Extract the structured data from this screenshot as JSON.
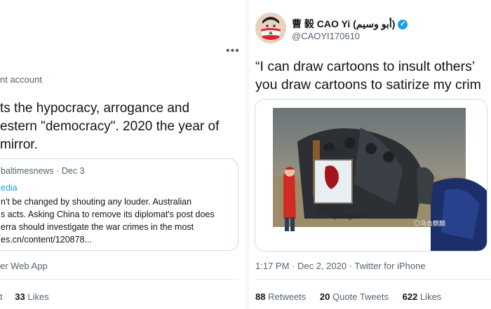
{
  "left_tweet": {
    "author_note": "nt account",
    "body_lines": [
      "ts the hypocracy, arrogance and",
      "estern \"democracy\". 2020 the year of",
      " mirror."
    ],
    "quote": {
      "handle_date": "baltimesnews · Dec 3",
      "label": "edia",
      "lines": [
        "n't be changed by shouting any louder. Australian",
        "s acts. Asking China to remove its diplomat's post does",
        "erra should investigate the war crimes in the most",
        "es.cn/content/120878..."
      ]
    },
    "source": "er Web App",
    "stats": {
      "partial_label": "t",
      "likes_count": "33",
      "likes_label": "Likes"
    }
  },
  "right_tweet": {
    "display_name": "曹 毅 CAO Yi (أبو وسيم)",
    "handle": "@CAOYI170610",
    "body_lines": [
      "“I can draw cartoons to insult others’",
      "you draw cartoons to satirize my crim"
    ],
    "image_caption": "-apologize!!-",
    "image_watermark": "◎乌合麒麟",
    "timestamp": "1:17 PM · Dec 2, 2020 · Twitter for iPhone",
    "stats": {
      "retweets_count": "88",
      "retweets_label": "Retweets",
      "quote_count": "20",
      "quote_label": "Quote Tweets",
      "likes_count": "622",
      "likes_label": "Likes"
    }
  },
  "colors": {
    "link_blue": "#1d9bf0",
    "text": "#0f1419",
    "secondary": "#536471",
    "border": "#cfd9de"
  },
  "icons": [
    "more-icon",
    "verified-icon",
    "avatar",
    "lebanon-flag-mask"
  ]
}
